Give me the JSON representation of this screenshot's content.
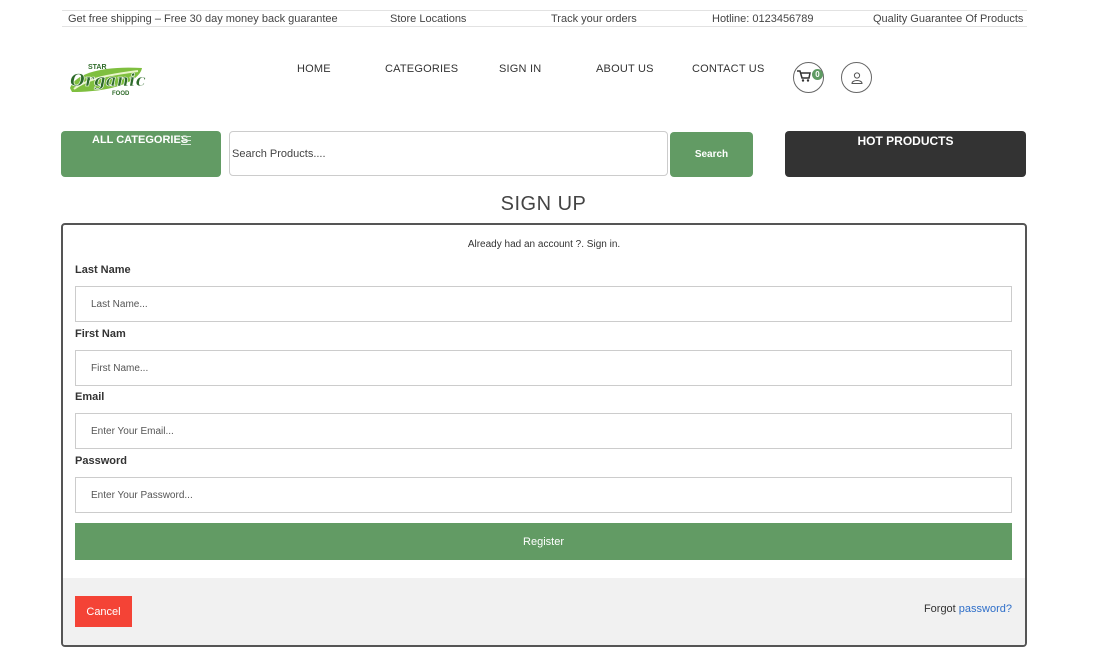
{
  "topbar": {
    "shipping": "Get free shipping – Free 30 day money back guarantee",
    "store_locations": "Store Locations",
    "track_orders": "Track your orders",
    "hotline": "Hotline: 0123456789",
    "quality": "Quality Guarantee Of Products"
  },
  "logo": {
    "text_top": "STAR",
    "text_main": "Organic",
    "text_bottom": "FOOD"
  },
  "nav": {
    "home": "HOME",
    "categories": "CATEGORIES",
    "sign_in": "SIGN IN",
    "about": "ABOUT US",
    "contact": "CONTACT US"
  },
  "cart": {
    "count": "0"
  },
  "toolbar": {
    "all_categories": "ALL CATEGORIES",
    "search_placeholder": "Search Products....",
    "search_button": "Search",
    "hot_products": "HOT PRODUCTS"
  },
  "page": {
    "title": "SIGN UP"
  },
  "form": {
    "already": "Already had an account ?. Sign in.",
    "last_name_label": "Last Name",
    "last_name_placeholder": "Last Name...",
    "first_name_label": "First Nam",
    "first_name_placeholder": "First Name...",
    "email_label": "Email",
    "email_placeholder": "Enter Your Email...",
    "password_label": "Password",
    "password_placeholder": "Enter Your Password...",
    "register": "Register",
    "cancel": "Cancel",
    "forgot_prefix": "Forgot ",
    "forgot_link": "password?"
  },
  "colors": {
    "accent_green": "#629b64",
    "dark": "#333333",
    "cancel_red": "#f44336",
    "link_blue": "#2f6fc9"
  },
  "icons": {
    "menu": "hamburger-icon",
    "cart": "cart-icon",
    "user": "user-icon"
  }
}
